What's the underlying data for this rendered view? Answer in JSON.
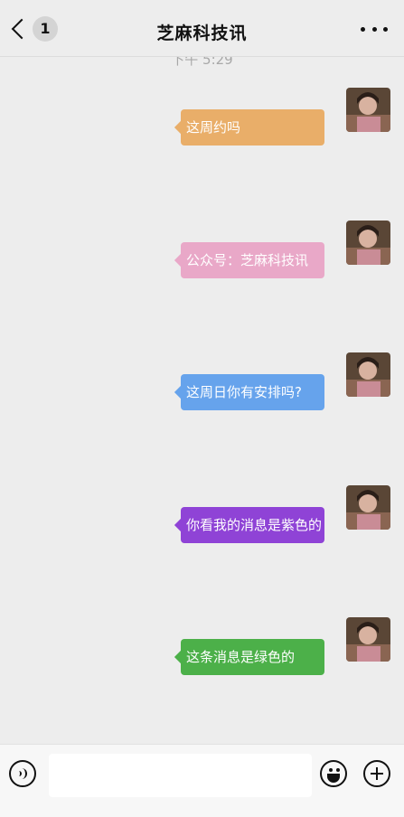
{
  "header": {
    "back_badge": "1",
    "title": "芝麻科技讯",
    "more_icon": "more-dots-icon"
  },
  "chat": {
    "timestamp": "下午 5:29",
    "messages": [
      {
        "text": "这周约吗",
        "color": "#e9ae69"
      },
      {
        "text": "公众号：芝麻科技讯",
        "color": "#e9a8c8"
      },
      {
        "text": "这周日你有安排吗?",
        "color": "#66a3ec"
      },
      {
        "text": "你看我的消息是紫色的",
        "color": "#8f43d6"
      },
      {
        "text": "这条消息是绿色的",
        "color": "#4cb049"
      }
    ]
  },
  "input_bar": {
    "voice_icon": "voice-icon",
    "emoji_icon": "emoji-icon",
    "plus_icon": "plus-icon"
  }
}
